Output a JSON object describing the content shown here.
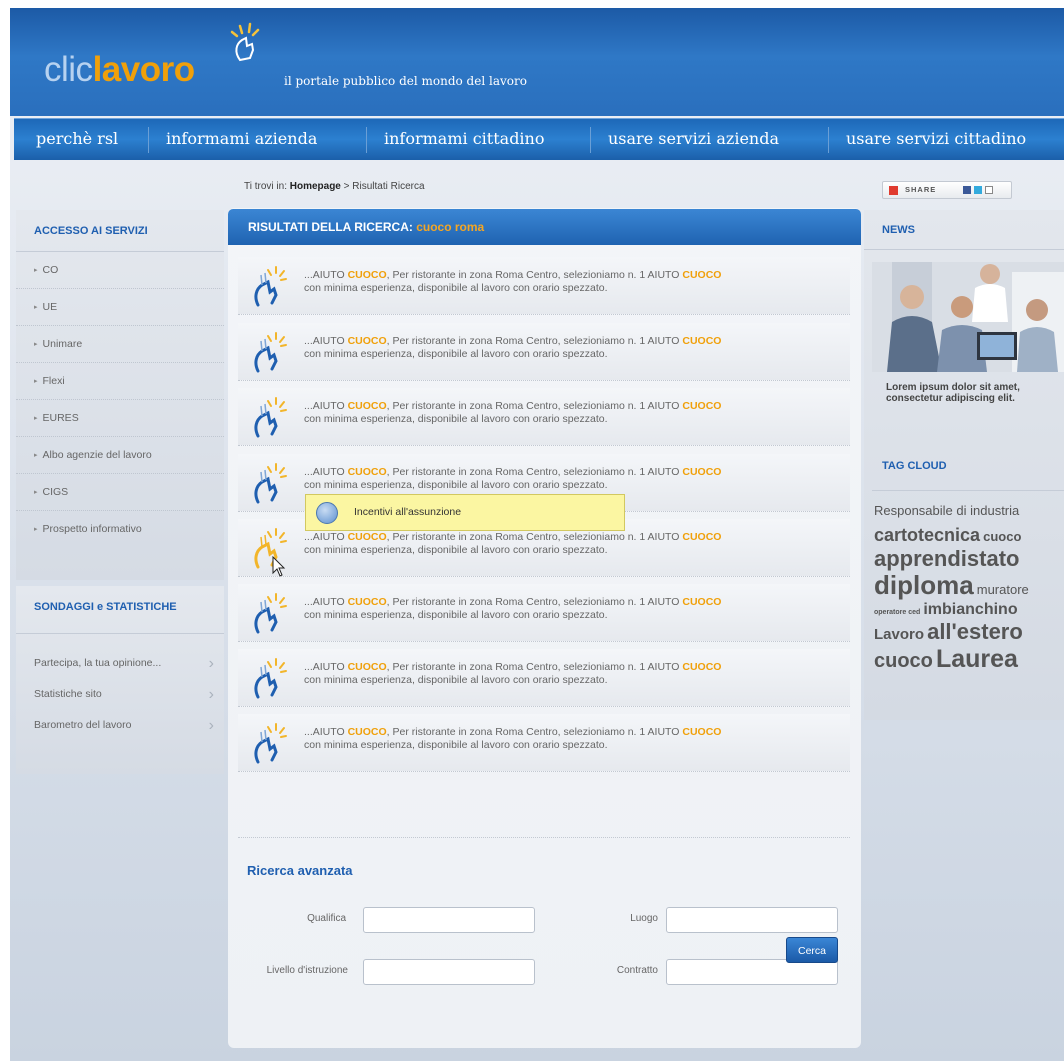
{
  "header": {
    "logo_clic": "clic",
    "logo_lavoro": "lavoro",
    "tagline": "il portale pubblico del mondo del lavoro"
  },
  "nav": {
    "items": [
      "perchè rsl",
      "informami azienda",
      "informami cittadino",
      "usare servizi azienda",
      "usare servizi cittadino"
    ]
  },
  "breadcrumb": {
    "prefix": "Ti trovi in:",
    "home": "Homepage",
    "sep": ">",
    "current": "Risultati Ricerca"
  },
  "left": {
    "access_title": "ACCESSO AI SERVIZI",
    "access_items": [
      "CO",
      "UE",
      "Unimare",
      "Flexi",
      "EURES",
      "Albo agenzie del lavoro",
      "CIGS",
      "Prospetto informativo"
    ],
    "sondaggi_title": "SONDAGGI e STATISTICHE",
    "sondaggi_items": [
      "Partecipa, la tua opinione...",
      "Statistiche sito",
      "Barometro del lavoro"
    ]
  },
  "results": {
    "title": "RISULTATI DELLA RICERCA:",
    "query": "cuoco roma",
    "items": [
      {
        "pre": "...AIUTO ",
        "hl1": "CUOCO",
        "mid": ", Per ristorante in zona Roma Centro, selezioniamo n. 1 AIUTO ",
        "hl2": "CUOCO",
        "line2": "con minima esperienza, disponibile al lavoro con orario spezzato."
      },
      {
        "pre": "...AIUTO ",
        "hl1": "CUOCO",
        "mid": ", Per ristorante in zona Roma Centro, selezioniamo n. 1 AIUTO ",
        "hl2": "CUOCO",
        "line2": "con minima esperienza, disponibile al lavoro con orario spezzato."
      },
      {
        "pre": "...AIUTO ",
        "hl1": "CUOCO",
        "mid": ", Per ristorante in zona Roma Centro, selezioniamo n. 1 AIUTO ",
        "hl2": "CUOCO",
        "line2": "con minima esperienza, disponibile al lavoro con orario spezzato."
      },
      {
        "pre": "...AIUTO ",
        "hl1": "CUOCO",
        "mid": ", Per ristorante in zona Roma Centro, selezioniamo n. 1 AIUTO ",
        "hl2": "CUOCO",
        "line2": "con minima esperienza, disponibile al lavoro con orario spezzato."
      },
      {
        "pre": "...AIUTO ",
        "hl1": "CUOCO",
        "mid": ", Per ristorante in zona Roma Centro, selezioniamo n. 1 AIUTO ",
        "hl2": "CUOCO",
        "line2": "con minima esperienza, disponibile al lavoro con orario spezzato."
      },
      {
        "pre": "...AIUTO ",
        "hl1": "CUOCO",
        "mid": ", Per ristorante in zona Roma Centro, selezioniamo n. 1 AIUTO ",
        "hl2": "CUOCO",
        "line2": "con minima esperienza, disponibile al lavoro con orario spezzato."
      },
      {
        "pre": "...AIUTO ",
        "hl1": "CUOCO",
        "mid": ", Per ristorante in zona Roma Centro, selezioniamo n. 1 AIUTO ",
        "hl2": "CUOCO",
        "line2": "con minima esperienza, disponibile al lavoro con orario spezzato."
      },
      {
        "pre": "...AIUTO ",
        "hl1": "CUOCO",
        "mid": ", Per ristorante in zona Roma Centro, selezioniamo n. 1 AIUTO ",
        "hl2": "CUOCO",
        "line2": "con minima esperienza, disponibile al lavoro con orario spezzato."
      }
    ],
    "tooltip": "Incentivi all'assunzione"
  },
  "advanced": {
    "title": "Ricerca avanzata",
    "qualifica_label": "Qualifica",
    "qualifica_value": "",
    "luogo_label": "Luogo",
    "luogo_value": "",
    "livello_label": "Livello d'istruzione",
    "livello_value": "",
    "contratto_label": "Contratto",
    "contratto_value": "",
    "button": "Cerca"
  },
  "right": {
    "share_label": "SHARE",
    "news_title": "NEWS",
    "news_text": "Lorem ipsum dolor sit amet, consectetur adipiscing elit.",
    "tag_title": "TAG CLOUD",
    "tags": {
      "t1": "Responsabile di industria",
      "t2": "cartotecnica",
      "t3": "cuoco",
      "t4": "apprendistato",
      "t5": "diploma",
      "t6": "muratore",
      "t7": "operatore ced",
      "t8": "imbianchino",
      "t9": "Lavoro",
      "t10": "all'estero",
      "t11": "cuoco",
      "t12": "Laurea"
    }
  },
  "colors": {
    "brand_blue": "#1f5fb0",
    "highlight_orange": "#f0a00a",
    "tooltip_yellow": "#fbf6a2"
  }
}
